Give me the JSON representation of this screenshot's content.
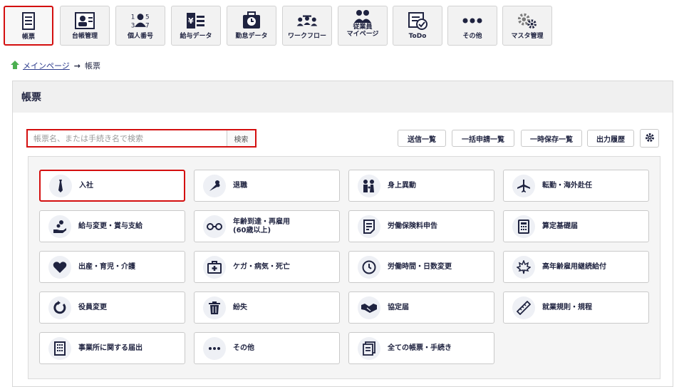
{
  "toolbar": {
    "items": [
      {
        "label": "帳票",
        "icon": "document-icon"
      },
      {
        "label": "台帳管理",
        "icon": "ledger-icon"
      },
      {
        "label": "個人番号",
        "icon": "personal-number-icon"
      },
      {
        "label": "給与データ",
        "icon": "salary-icon"
      },
      {
        "label": "勤怠データ",
        "icon": "attendance-icon"
      },
      {
        "label": "ワークフロー",
        "icon": "workflow-icon"
      },
      {
        "label": "従業員\nマイページ",
        "icon": "employee-page-icon"
      },
      {
        "label": "ToDo",
        "icon": "todo-icon"
      },
      {
        "label": "その他",
        "icon": "more-icon"
      },
      {
        "label": "マスタ管理",
        "icon": "gears-icon"
      }
    ]
  },
  "breadcrumb": {
    "home": "メインページ",
    "current": "帳票"
  },
  "page_title": "帳票",
  "search": {
    "placeholder": "帳票名、または手続き名で検索",
    "button": "検索"
  },
  "actions": {
    "sent_list": "送信一覧",
    "bulk_list": "一括申請一覧",
    "draft_list": "一時保存一覧",
    "history": "出力履歴"
  },
  "cards": [
    {
      "label": "入社",
      "icon": "necktie-icon"
    },
    {
      "label": "退職",
      "icon": "bouquet-icon"
    },
    {
      "label": "身上異動",
      "icon": "family-icon"
    },
    {
      "label": "転勤・海外赴任",
      "icon": "airplane-icon"
    },
    {
      "label": "給与変更・賞与支給",
      "icon": "hand-coins-icon"
    },
    {
      "label": "年齢到達・再雇用\n(60歳以上)",
      "icon": "glasses-icon"
    },
    {
      "label": "労働保険料申告",
      "icon": "form-icon"
    },
    {
      "label": "算定基礎届",
      "icon": "calculator-icon"
    },
    {
      "label": "出産・育児・介護",
      "icon": "heart-icon"
    },
    {
      "label": "ケガ・病気・死亡",
      "icon": "first-aid-icon"
    },
    {
      "label": "労働時間・日数変更",
      "icon": "clock-icon"
    },
    {
      "label": "高年齢雇用継続給付",
      "icon": "maple-leaf-icon"
    },
    {
      "label": "役員変更",
      "icon": "refresh-icon"
    },
    {
      "label": "紛失",
      "icon": "trash-icon"
    },
    {
      "label": "協定届",
      "icon": "handshake-icon"
    },
    {
      "label": "就業規則・規程",
      "icon": "ruler-icon"
    },
    {
      "label": "事業所に関する届出",
      "icon": "building-icon"
    },
    {
      "label": "その他",
      "icon": "more-icon"
    },
    {
      "label": "全ての帳票・手続き",
      "icon": "documents-icon"
    }
  ],
  "colors": {
    "accent": "#1f2340",
    "highlight": "#d40f0f",
    "home_icon": "#4caf50",
    "link": "#2b3a8c"
  }
}
